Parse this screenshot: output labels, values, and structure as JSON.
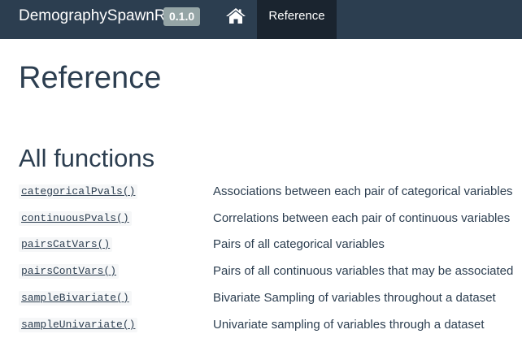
{
  "navbar": {
    "brand": "DemographySpawnR",
    "version": "0.1.0",
    "home_icon": "home-icon",
    "active_tab": "Reference"
  },
  "main": {
    "title": "Reference",
    "section_title": "All functions",
    "functions": [
      {
        "name": "categoricalPvals()",
        "description": "Associations between each pair of categorical variables"
      },
      {
        "name": "continuousPvals()",
        "description": "Correlations between each pair of continuous variables"
      },
      {
        "name": "pairsCatVars()",
        "description": "Pairs of all categorical variables"
      },
      {
        "name": "pairsContVars()",
        "description": "Pairs of all continuous variables that may be associated"
      },
      {
        "name": "sampleBivariate()",
        "description": "Bivariate Sampling of variables throughout a dataset"
      },
      {
        "name": "sampleUnivariate()",
        "description": "Univariate sampling of variables through a dataset"
      }
    ]
  },
  "colors": {
    "navbar_bg": "#2c3e50",
    "navbar_active_bg": "#1a242f",
    "version_badge_bg": "#95a5a6",
    "text": "#2c3e50"
  }
}
